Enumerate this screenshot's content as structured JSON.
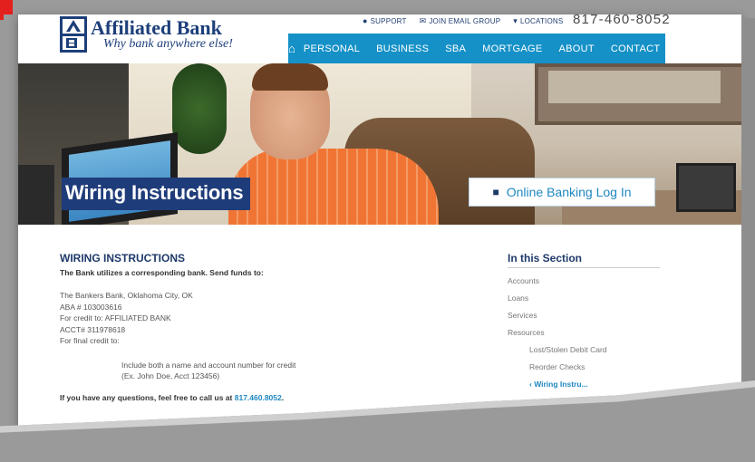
{
  "brand": {
    "name": "Affiliated Bank",
    "tagline": "Why bank anywhere else!"
  },
  "utility": {
    "support": "SUPPORT",
    "email": "JOIN EMAIL GROUP",
    "locations": "LOCATIONS",
    "phone": "817-460-8052"
  },
  "nav": {
    "items": [
      "PERSONAL",
      "BUSINESS",
      "SBA",
      "MORTGAGE",
      "ABOUT",
      "CONTACT"
    ]
  },
  "hero": {
    "title": "Wiring Instructions",
    "login": "Online Banking Log In"
  },
  "main": {
    "heading": "WIRING INSTRUCTIONS",
    "intro": "The Bank utilizes a corresponding bank.  Send funds to:",
    "address": [
      "The Bankers Bank, Oklahoma City, OK",
      "ABA # 103003616",
      "For credit to: AFFILIATED BANK",
      "ACCT# 311978618"
    ],
    "final_label": "For final credit to:",
    "note_1": "Include both a name and account number for credit",
    "note_2": "(Ex. John Doe, Acct 123456)",
    "cta_text": "If you have any questions, feel free to call us at ",
    "cta_phone": "817.460.8052",
    "cta_end": "."
  },
  "sidebar": {
    "title": "In this Section",
    "items": [
      "Accounts",
      "Loans",
      "Services",
      "Resources"
    ],
    "sub_items": [
      "Lost/Stolen Debit Card",
      "Reorder Checks"
    ],
    "active": "‹ Wiring Instru..."
  },
  "colors": {
    "brand_navy": "#1d3f7a",
    "nav_blue": "#1591c7",
    "link_blue": "#1e88c1"
  }
}
